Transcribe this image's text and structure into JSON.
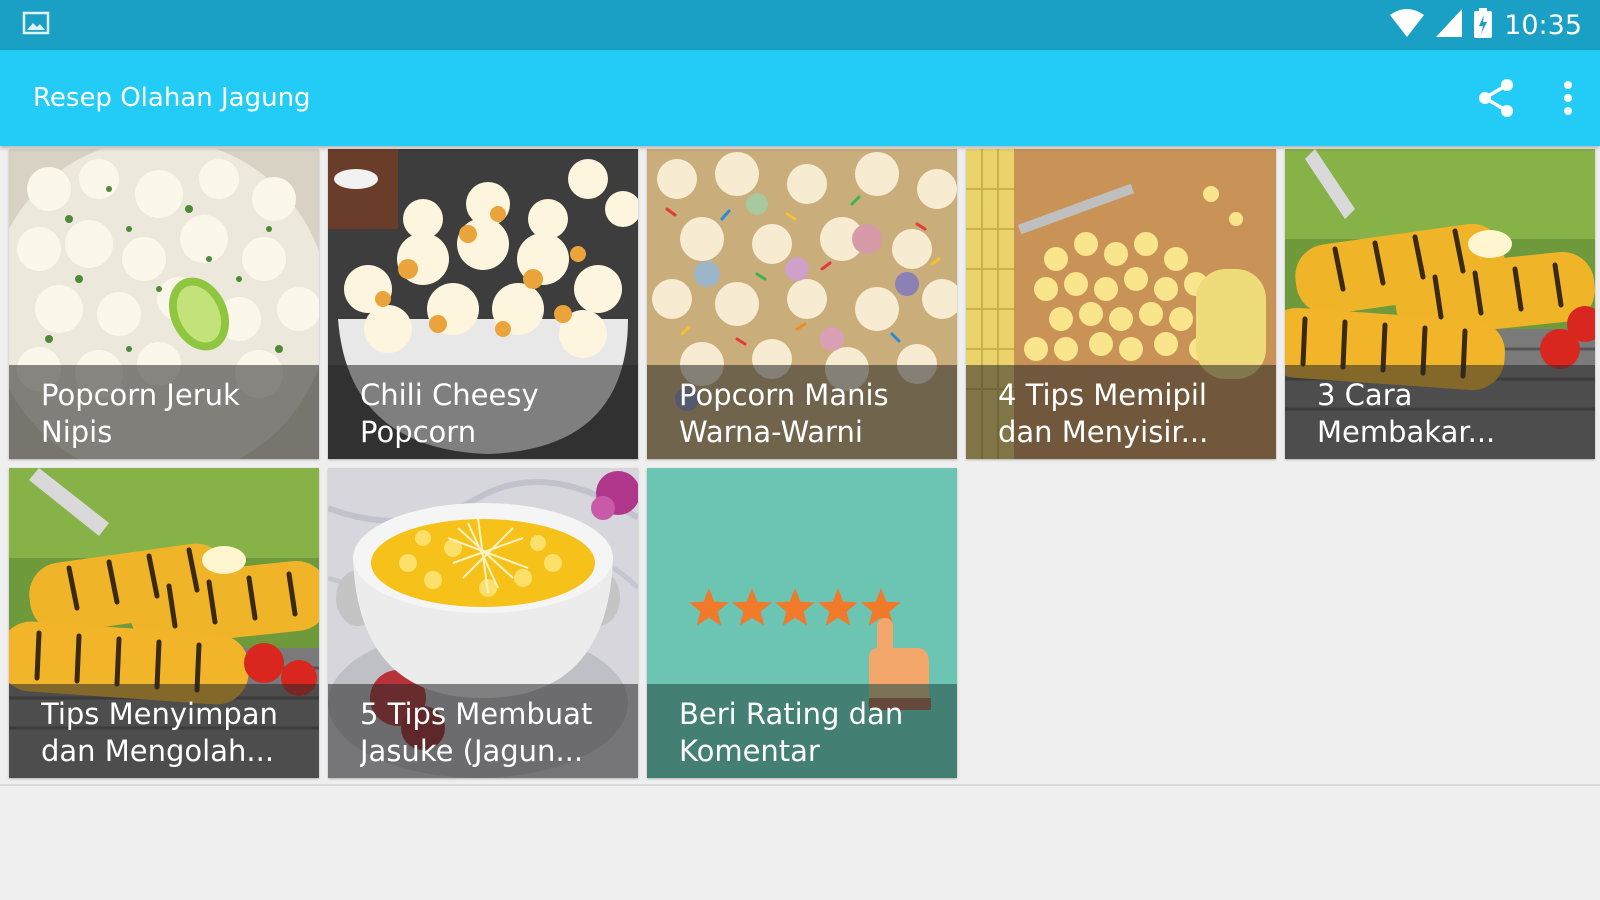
{
  "status_bar": {
    "time": "10:35",
    "icons": [
      "image-notification-icon",
      "wifi-icon",
      "cell-signal-icon",
      "battery-icon"
    ]
  },
  "app_bar": {
    "title": "Resep Olahan Jagung",
    "actions": [
      "share-icon",
      "more-vert-icon"
    ]
  },
  "tiles": [
    {
      "line1": "Popcorn Jeruk",
      "line2": "Nipis"
    },
    {
      "line1": "Chili Cheesy",
      "line2": "Popcorn"
    },
    {
      "line1": "Popcorn Manis",
      "line2": "Warna-Warni"
    },
    {
      "line1": "4 Tips Memipil",
      "line2": "dan Menyisir..."
    },
    {
      "line1": "3 Cara",
      "line2": "Membakar..."
    },
    {
      "line1": "Tips Menyimpan",
      "line2": "dan Mengolah..."
    },
    {
      "line1": "5 Tips Membuat",
      "line2": "Jasuke (Jagun..."
    },
    {
      "line1": "Beri Rating dan",
      "line2": "Komentar"
    }
  ],
  "colors": {
    "status_bar": "#1aa0c4",
    "app_bar": "#22ccf6",
    "background": "#efefef",
    "rating_tile": "#6cc5b3",
    "star": "#f07a2a"
  }
}
